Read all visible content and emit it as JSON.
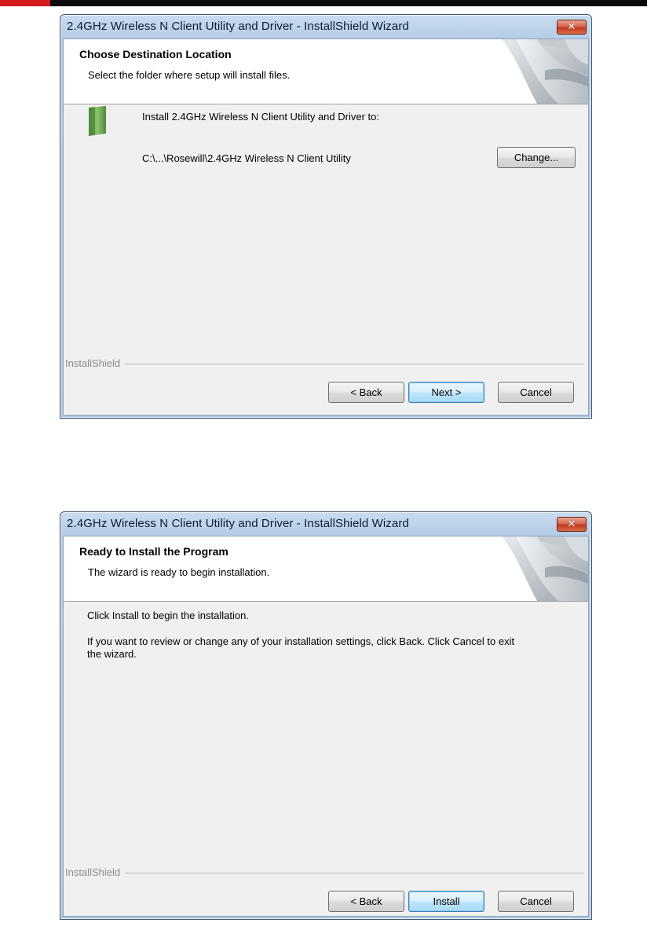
{
  "page": {
    "accent_colors": {
      "red_bar": "#d71920",
      "dark_bar": "#0a0a0a"
    }
  },
  "dialog1": {
    "title": "2.4GHz Wireless N Client Utility and Driver - InstallShield Wizard",
    "close_icon": "close-icon",
    "header_title": "Choose Destination Location",
    "header_subtitle": "Select the folder where setup will install files.",
    "install_to_label": "Install 2.4GHz Wireless N Client Utility and Driver to:",
    "path": "C:\\...\\Rosewill\\2.4GHz Wireless N Client Utility",
    "folder_icon": "folder-icon",
    "change_button": "Change...",
    "brand": "InstallShield",
    "back_button": "< Back",
    "next_button": "Next >",
    "cancel_button": "Cancel"
  },
  "dialog2": {
    "title": "2.4GHz Wireless N Client Utility and Driver - InstallShield Wizard",
    "close_icon": "close-icon",
    "header_title": "Ready to Install the Program",
    "header_subtitle": "The wizard is ready to begin installation.",
    "line1": "Click Install to begin the installation.",
    "line2a": "If you want to review or change any of your installation settings, click Back. Click Cancel to exit",
    "line2b": "the wizard.",
    "brand": "InstallShield",
    "back_button": "< Back",
    "install_button": "Install",
    "cancel_button": "Cancel"
  }
}
